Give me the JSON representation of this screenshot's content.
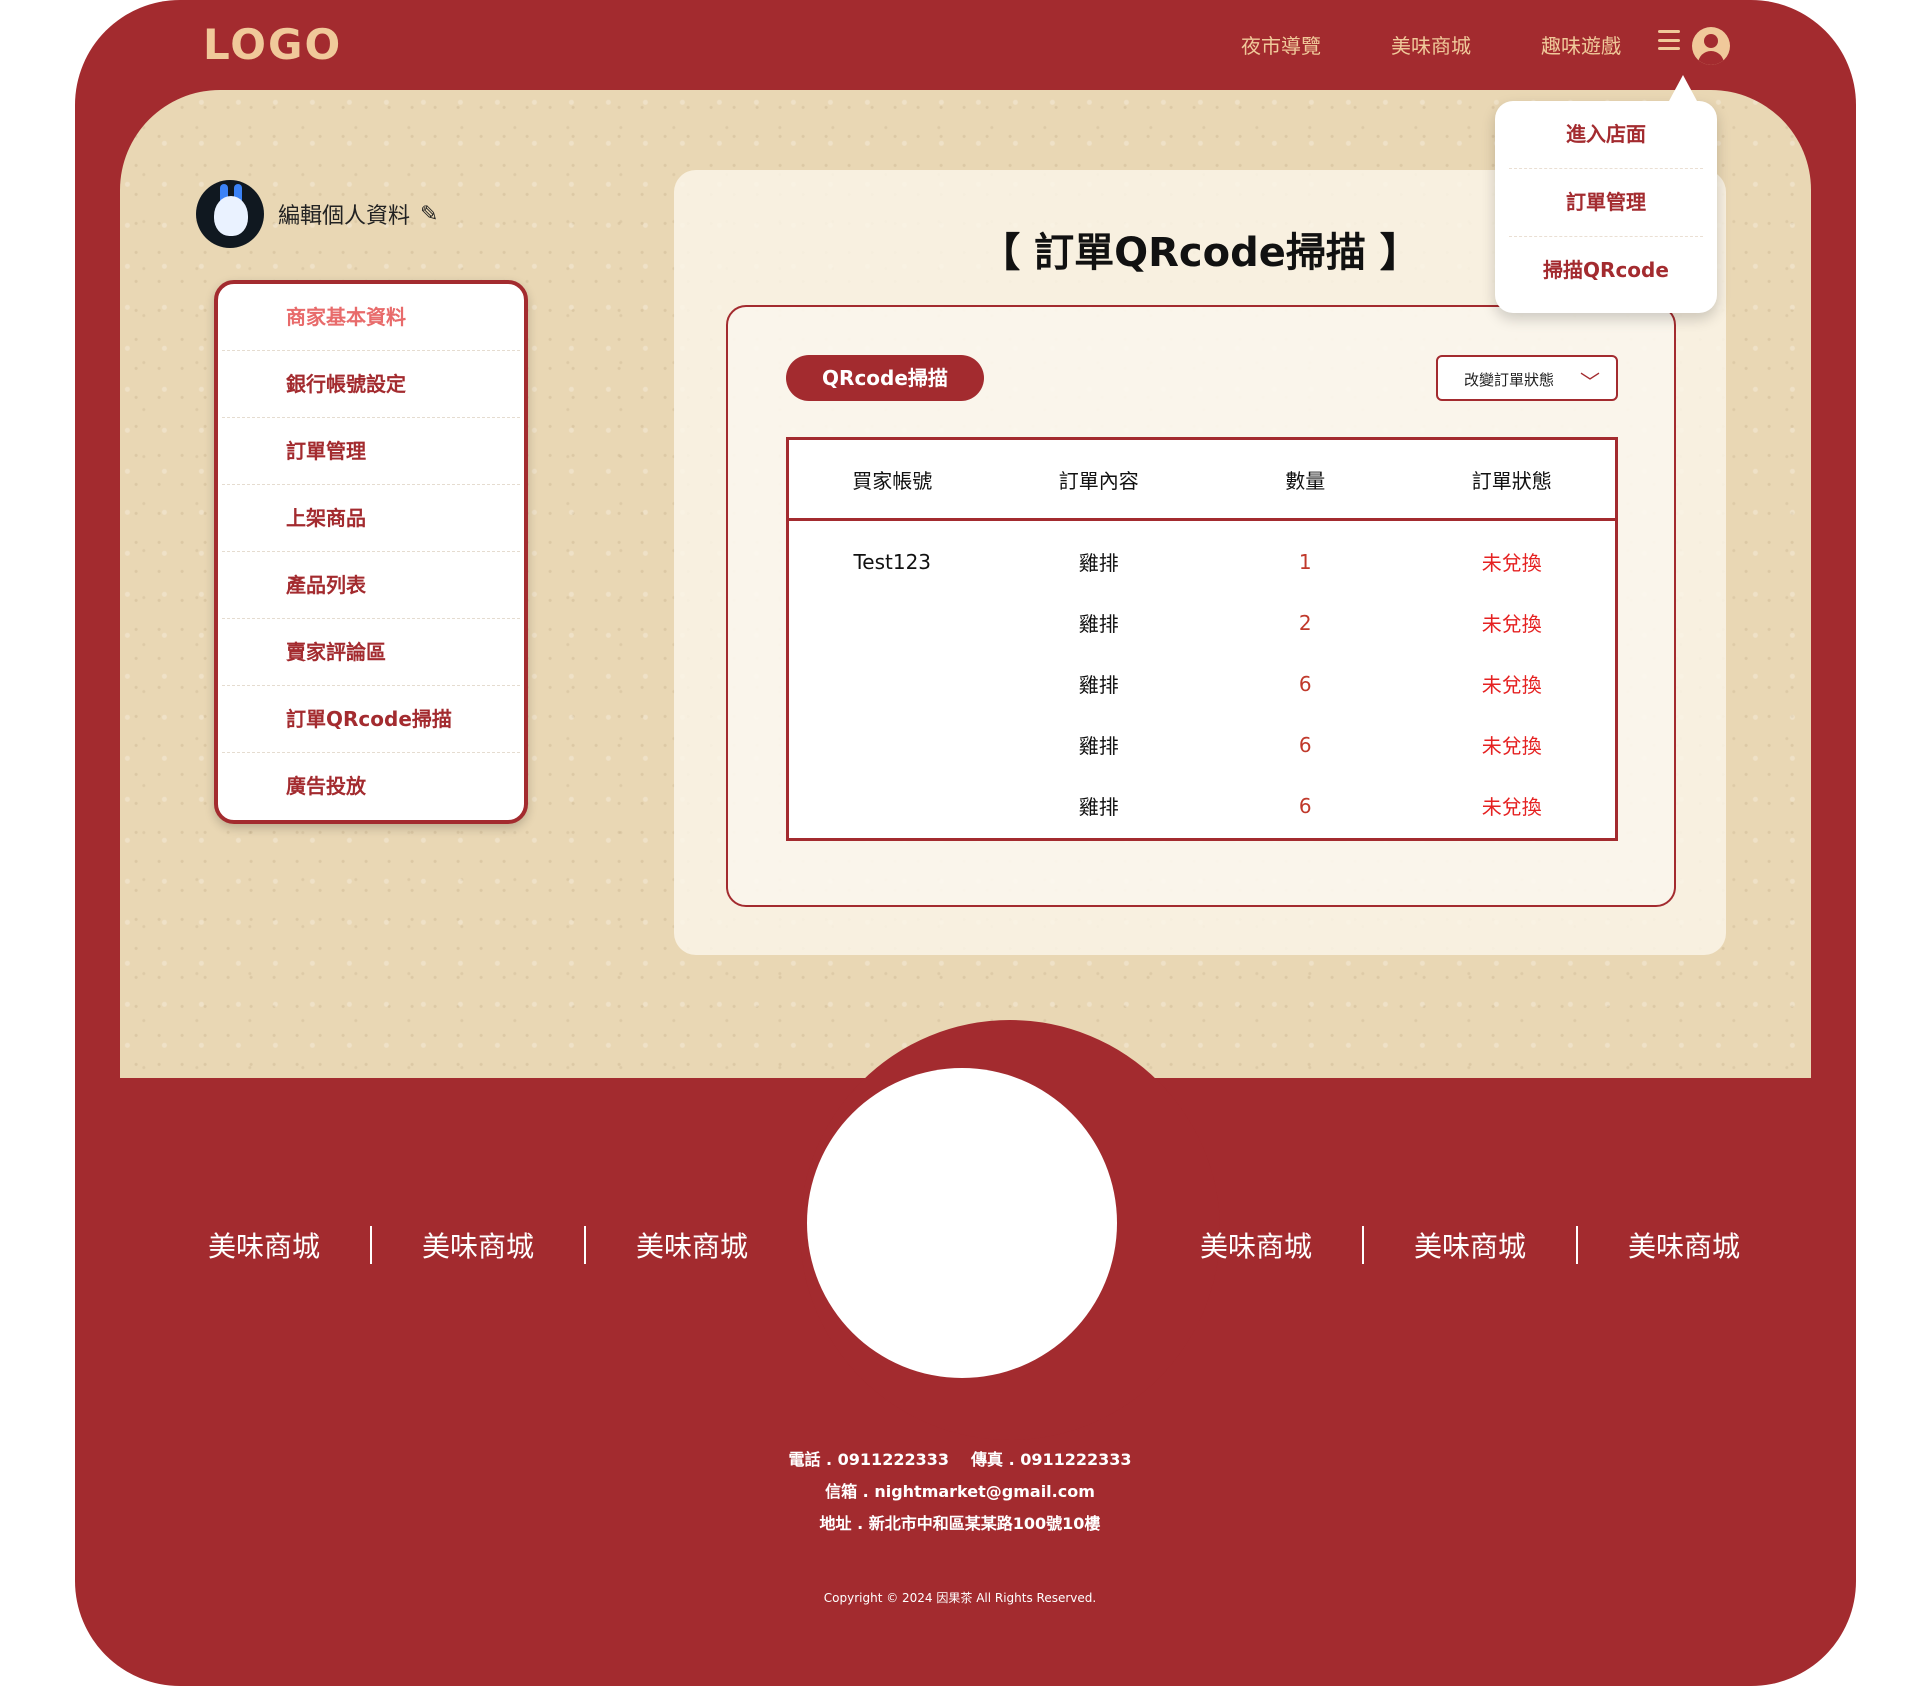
{
  "header": {
    "logo": "LOGO",
    "nav": [
      "夜市導覽",
      "美味商城",
      "趣味遊戲"
    ]
  },
  "profile": {
    "edit_label": "編輯個人資料"
  },
  "sidebar": {
    "items": [
      "商家基本資料",
      "銀行帳號設定",
      "訂單管理",
      "上架商品",
      "產品列表",
      "賣家評論區",
      "訂單QRcode掃描",
      "廣告投放"
    ],
    "active_index": 0
  },
  "main": {
    "title": "【 訂單QRcode掃描 】",
    "qr_button": "QRcode掃描",
    "status_select": "改變訂單狀態",
    "table": {
      "headers": [
        "買家帳號",
        "訂單內容",
        "數量",
        "訂單狀態"
      ],
      "rows": [
        [
          "Test123",
          "雞排",
          "1",
          "未兌換"
        ],
        [
          "",
          "雞排",
          "2",
          "未兌換"
        ],
        [
          "",
          "雞排",
          "6",
          "未兌換"
        ],
        [
          "",
          "雞排",
          "6",
          "未兌換"
        ],
        [
          "",
          "雞排",
          "6",
          "未兌換"
        ]
      ]
    }
  },
  "dropdown": {
    "items": [
      "進入店面",
      "訂單管理",
      "掃描QRcode"
    ]
  },
  "footer": {
    "links_left": [
      "美味商城",
      "美味商城",
      "美味商城"
    ],
    "links_right": [
      "美味商城",
      "美味商城",
      "美味商城"
    ],
    "phone": "電話 . 0911222333",
    "fax": "傳真 . 0911222333",
    "email": "信箱 . nightmarket@gmail.com",
    "address": "地址 . 新北市中和區某某路100號10樓",
    "copyright": "Copyright © 2024 因果茶 All Rights Reserved."
  },
  "colors": {
    "brand_red": "#a32b2f",
    "accent_gold": "#f0c99a",
    "paper": "#e9d7b4",
    "status_red": "#e52121"
  }
}
